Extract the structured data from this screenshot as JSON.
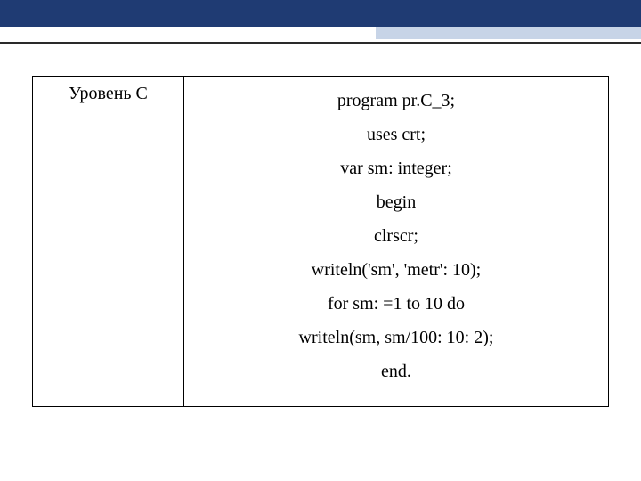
{
  "header": {
    "level_label": "Уровень С"
  },
  "code": {
    "lines": [
      "program pr.C_3;",
      "uses crt;",
      "var sm: integer;",
      "begin",
      "clrscr;",
      "writeln('sm', 'metr': 10);",
      "for sm: =1 to 10 do",
      "writeln(sm, sm/100: 10: 2);",
      "end."
    ]
  }
}
